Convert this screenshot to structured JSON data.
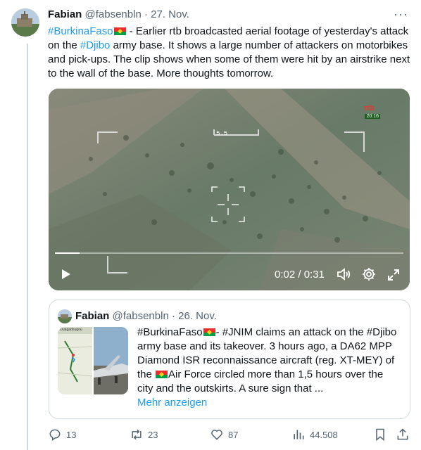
{
  "tweet": {
    "author_name": "Fabian",
    "author_handle": "@fabsenbln",
    "separator": "·",
    "date": "27. Nov.",
    "more_label": "···",
    "text_parts": {
      "hashtag1": "#BurkinaFaso",
      "text1": " - Earlier rtb broadcasted aerial footage of yesterday's attack on the ",
      "hashtag2": "#Djibo",
      "text2": " army base. It shows a large number of attackers on motorbikes and pick-ups. The clip shows when some of them were hit by an airstrike next to the wall of the base. More thoughts tomorrow."
    },
    "video": {
      "timestamp": "0:02 / 0:31",
      "progress_fraction": 0.07,
      "overlay_label": "5.5",
      "logo_text": "rtb",
      "logo_time": "20:16"
    }
  },
  "quote": {
    "author_name": "Fabian",
    "author_handle": "@fabsenbln",
    "separator": "·",
    "date": "26. Nov.",
    "text_parts": {
      "p1": "#BurkinaFaso",
      "p2": "- #JNIM claims an attack on the #Djibo army base and its takeover. 3 hours ago, a DA62 MPP Diamond ISR reconnaissance aircraft (reg. XT-MEY) of the ",
      "p3": "Air Force circled more than 1,5 hours over the city and the outskirts. A sure sign that ..."
    },
    "more_label": "Mehr anzeigen",
    "map_label": "Ouagadougou"
  },
  "actions": {
    "replies": "13",
    "retweets": "23",
    "likes": "87",
    "views": "44.508"
  },
  "colors": {
    "accent": "#1d9bf0",
    "secondary_text": "#536471",
    "border": "#cfd9de"
  }
}
